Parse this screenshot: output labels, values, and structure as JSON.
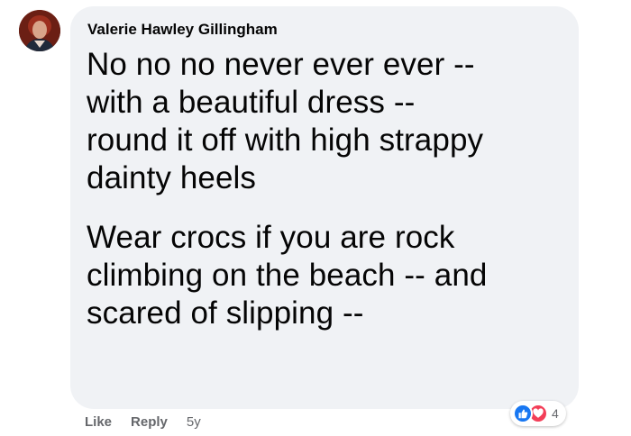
{
  "comment": {
    "author": "Valerie Hawley Gillingham",
    "paragraphs": [
      {
        "lines": [
          "No no no never ever ever --",
          "with a beautiful dress --",
          "round it off with high strappy",
          "dainty heels"
        ]
      },
      {
        "lines": [
          "Wear crocs if you are rock",
          "climbing on the beach -- and",
          "scared of slipping --"
        ]
      }
    ]
  },
  "actions": {
    "like_label": "Like",
    "reply_label": "Reply",
    "timestamp": "5y"
  },
  "reactions": {
    "icons": [
      "thumbs-up-icon",
      "heart-icon"
    ],
    "count": "4"
  },
  "colors": {
    "bubble_bg": "#f0f2f5",
    "text": "#050505",
    "secondary_text": "#65676b",
    "like_blue": "#1877f2",
    "love_red": "#f33e58"
  }
}
